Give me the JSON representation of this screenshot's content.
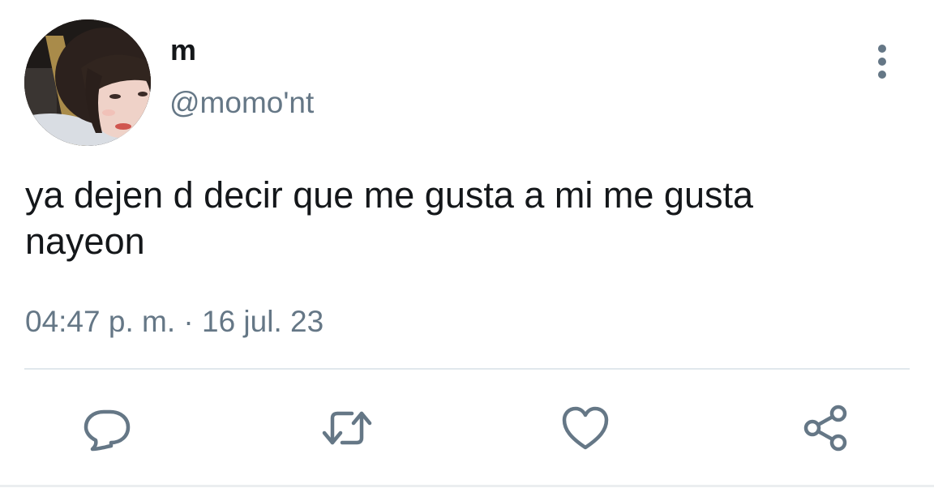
{
  "tweet": {
    "display_name": "m",
    "handle": "@momo'nt",
    "text_lines": [
      "ya dejen d decir que me gusta a mi me gusta",
      "nayeon"
    ],
    "time": "04:47 p. m.",
    "separator": "·",
    "date": "16 jul. 23"
  },
  "icons": {
    "more": "more-vertical-icon",
    "reply": "reply-icon",
    "retweet": "retweet-icon",
    "like": "heart-icon",
    "share": "share-icon"
  },
  "colors": {
    "text": "#14171a",
    "secondary": "#657786",
    "divider": "#e1e8ed"
  }
}
